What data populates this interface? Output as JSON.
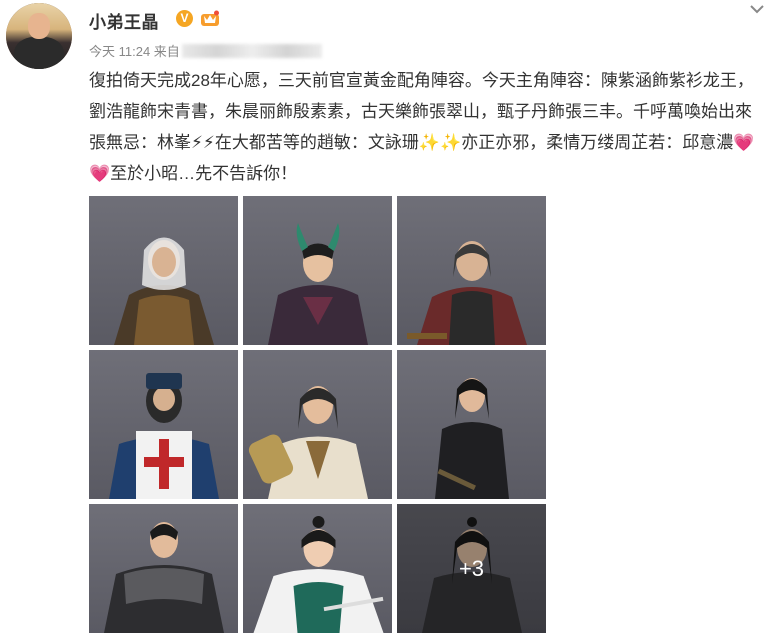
{
  "post": {
    "author": "小弟王晶",
    "verified_badge": "V",
    "time": "今天 11:24 来自",
    "content": "復拍倚天完成28年心愿，三天前官宣黃金配角陣容。今天主角陣容：陳紫涵飾紫衫龙王，劉浩龍飾宋青書，朱晨丽飾殷素素，古天樂飾張翠山，甄子丹飾張三丰。千呼萬喚始出來張無忌：林峯⚡⚡在大都苦等的趙敏：文詠珊✨✨亦正亦邪，柔情万缕周芷若：邱意濃💗💗至於小昭…先不告訴你！",
    "more_count": "+3"
  },
  "colors": {
    "verified": "#f5a623",
    "text": "#333333",
    "meta": "#888888"
  },
  "icons": {
    "member": "crown-member-icon",
    "menu": "chevron-down-icon"
  }
}
